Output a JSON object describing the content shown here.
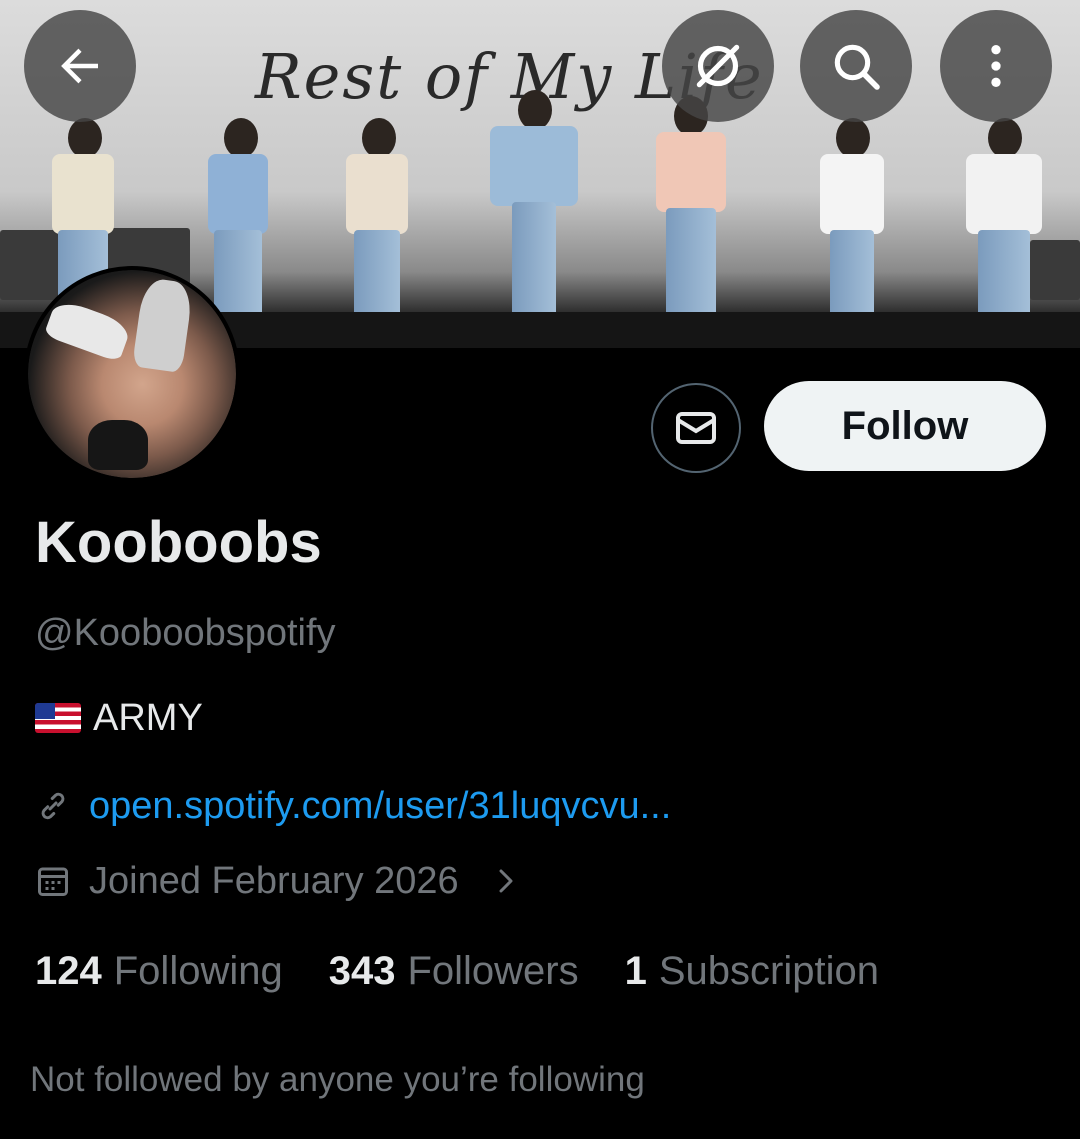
{
  "banner": {
    "text": "Rest of My Life"
  },
  "header": {
    "back_icon": "arrow-left-icon",
    "grok_icon": "grok-icon",
    "search_icon": "search-icon",
    "more_icon": "more-vertical-icon"
  },
  "actions": {
    "message_icon": "envelope-icon",
    "follow_label": "Follow"
  },
  "profile": {
    "display_name": "Kooboobs",
    "handle": "@Kooboobspotify",
    "bio_flag": "us-flag",
    "bio_text": "ARMY",
    "link_text": "open.spotify.com/user/31luqvcvu...",
    "joined_text": "Joined February 2026"
  },
  "stats": {
    "following_count": "124",
    "following_label": "Following",
    "followers_count": "343",
    "followers_label": "Followers",
    "subscription_count": "1",
    "subscription_label": "Subscription"
  },
  "footer": {
    "not_followed_text": "Not followed by anyone you’re following"
  },
  "colors": {
    "background": "#000000",
    "text_primary": "#e7e9ea",
    "text_secondary": "#71767b",
    "link": "#1d9bf0",
    "follow_button_bg": "#eff3f4"
  }
}
